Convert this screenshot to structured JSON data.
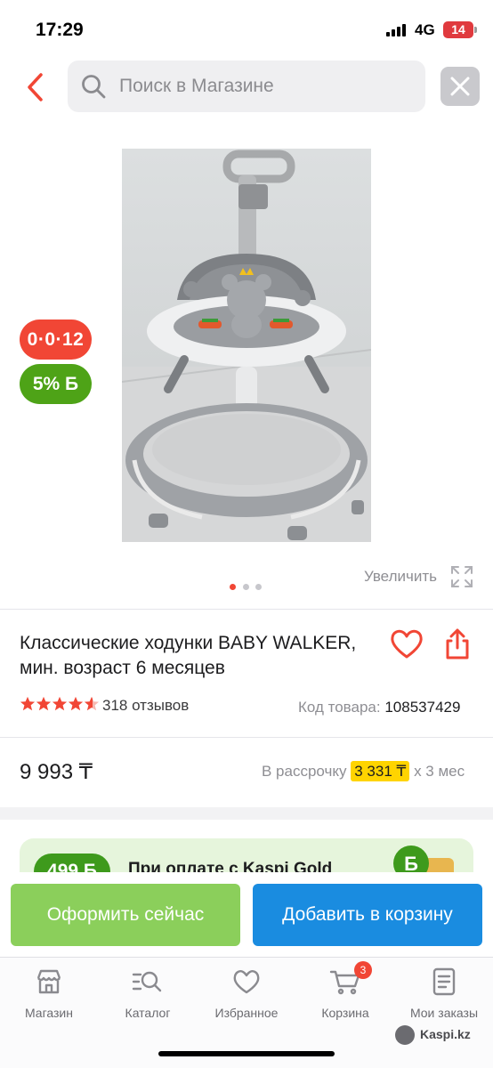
{
  "status_bar": {
    "time": "17:29",
    "network": "4G",
    "battery": "14"
  },
  "search": {
    "placeholder": "Поиск в Магазине"
  },
  "product": {
    "installment_badge": "0·0·12",
    "bonus_badge": "5% Б",
    "zoom_label": "Увеличить",
    "gallery": {
      "count": 3,
      "active": 0
    },
    "title": "Классические ходунки BABY WALKER, мин. возраст 6 месяцев",
    "rating": 4.5,
    "reviews": "318 отзывов",
    "sku_label": "Код товара:",
    "sku_value": "108537429",
    "price": "9 993 ₸",
    "installment_prefix": "В рассрочку",
    "installment_amount": "3 331 ₸",
    "installment_suffix": "х 3 мес"
  },
  "promo": {
    "amount": "499 Б",
    "text": "При оплате с Kaspi Gold"
  },
  "actions": {
    "buy_now": "Оформить сейчас",
    "add_to_cart": "Добавить в корзину"
  },
  "tabs": [
    {
      "label": "Магазин",
      "icon": "store-icon"
    },
    {
      "label": "Каталог",
      "icon": "catalog-search-icon"
    },
    {
      "label": "Избранное",
      "icon": "heart-icon"
    },
    {
      "label": "Корзина",
      "icon": "cart-icon",
      "badge": "3"
    },
    {
      "label": "Мои заказы",
      "icon": "orders-icon"
    }
  ],
  "watermark": "Kaspi.kz",
  "colors": {
    "accent_red": "#f14635",
    "green": "#4ea317",
    "blue": "#1a8ce0",
    "light_green": "#8bcf5b",
    "yellow": "#ffd400"
  }
}
